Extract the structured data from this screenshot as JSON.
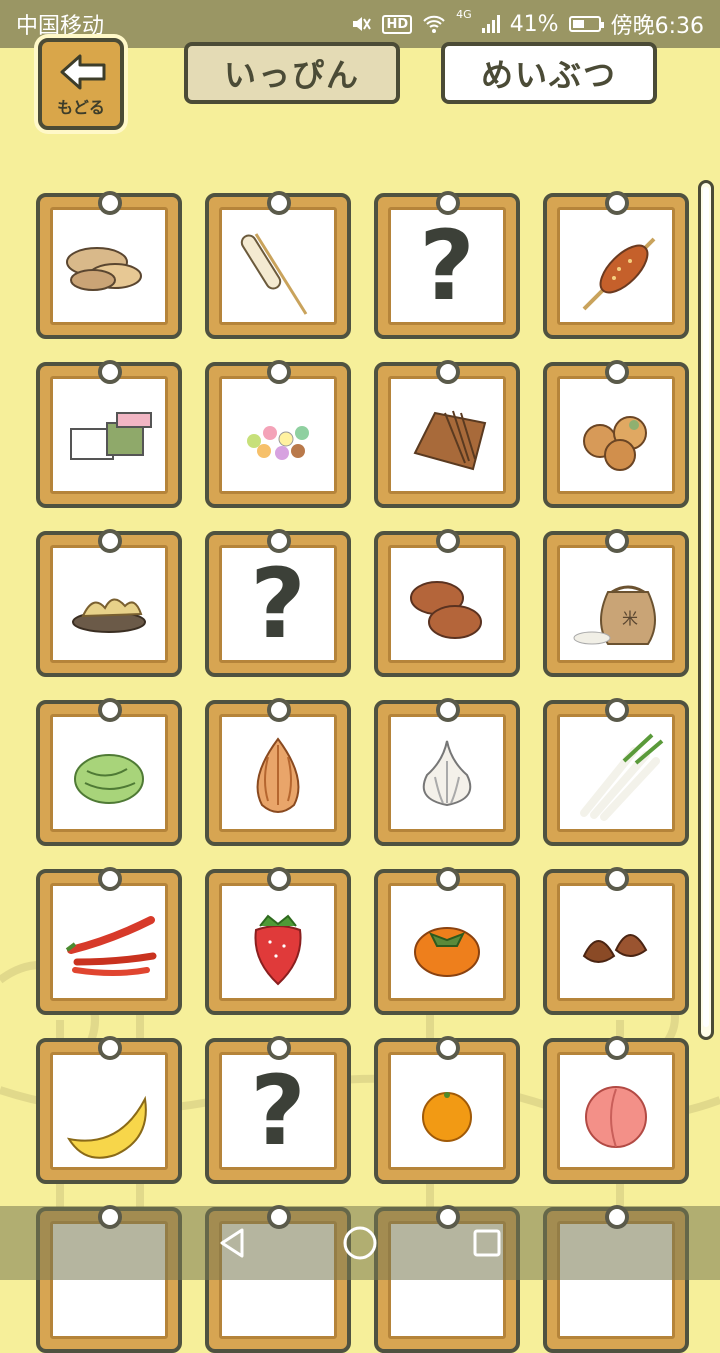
{
  "status_bar": {
    "carrier": "中国移动",
    "network": "4G",
    "battery": "41%",
    "time": "傍晚6:36"
  },
  "header": {
    "back_label": "もどる",
    "tabs": [
      "いっぴん",
      "めいぶつ"
    ],
    "active_tab": "いっぴん"
  },
  "items": [
    {
      "name": "senbei",
      "icon": "rice-cracker-icon"
    },
    {
      "name": "dango-stick",
      "icon": "skewer-icon"
    },
    {
      "name": "unknown",
      "icon": "question-mark-icon",
      "text": "?"
    },
    {
      "name": "grilled-mochi",
      "icon": "grilled-skewer-icon"
    },
    {
      "name": "yokan",
      "icon": "layered-sweets-icon"
    },
    {
      "name": "candies",
      "icon": "colorful-candy-icon"
    },
    {
      "name": "tsukudani",
      "icon": "pickled-icon"
    },
    {
      "name": "manju",
      "icon": "buns-icon"
    },
    {
      "name": "tempura",
      "icon": "fried-food-icon"
    },
    {
      "name": "unknown",
      "icon": "question-mark-icon",
      "text": "?"
    },
    {
      "name": "bread",
      "icon": "bread-icon"
    },
    {
      "name": "rice-bag",
      "icon": "rice-bag-icon"
    },
    {
      "name": "cabbage",
      "icon": "cabbage-icon"
    },
    {
      "name": "onion",
      "icon": "onion-icon"
    },
    {
      "name": "garlic",
      "icon": "garlic-icon"
    },
    {
      "name": "green-onion",
      "icon": "leek-icon"
    },
    {
      "name": "chili",
      "icon": "chili-icon"
    },
    {
      "name": "strawberry",
      "icon": "strawberry-icon"
    },
    {
      "name": "persimmon",
      "icon": "persimmon-icon"
    },
    {
      "name": "chestnut",
      "icon": "chestnut-icon"
    },
    {
      "name": "banana",
      "icon": "banana-icon"
    },
    {
      "name": "unknown",
      "icon": "question-mark-icon",
      "text": "?"
    },
    {
      "name": "mandarin",
      "icon": "orange-icon"
    },
    {
      "name": "peach",
      "icon": "peach-icon"
    }
  ],
  "colors": {
    "background": "#f6ef9a",
    "card_wood": "#d7a552",
    "frame": "#4f5240"
  }
}
